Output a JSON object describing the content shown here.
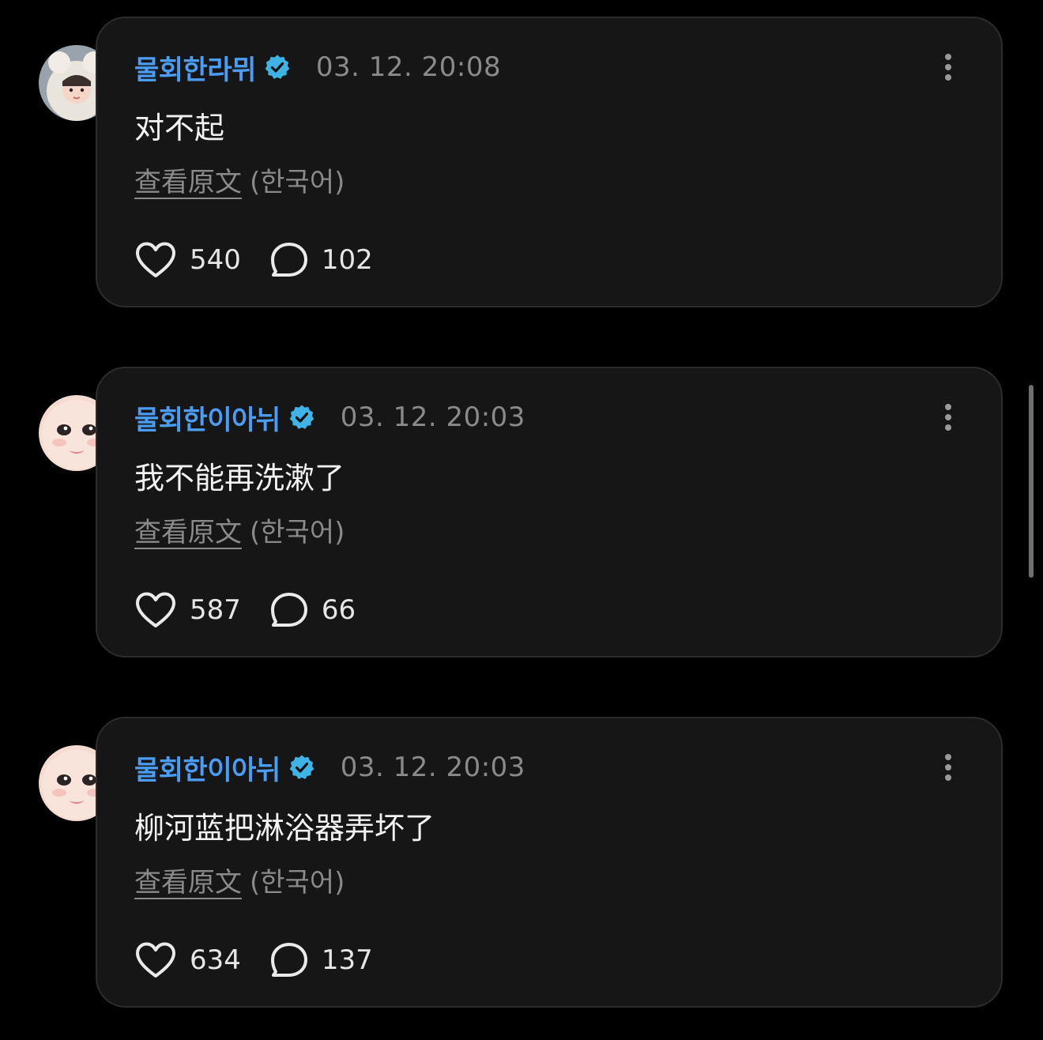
{
  "posts": [
    {
      "avatar_icon": "user-avatar-1",
      "username": "물회한라뮈",
      "timestamp": "03. 12. 20:08",
      "content": "对不起",
      "translate_label": "查看原文",
      "language": "(한국어)",
      "likes": "540",
      "comments": "102"
    },
    {
      "avatar_icon": "user-avatar-2",
      "username": "물회한이아뉘",
      "timestamp": "03. 12. 20:03",
      "content": "我不能再洗漱了",
      "translate_label": "查看原文",
      "language": "(한국어)",
      "likes": "587",
      "comments": "66"
    },
    {
      "avatar_icon": "user-avatar-2",
      "username": "물회한이아뉘",
      "timestamp": "03. 12. 20:03",
      "content": "柳河蓝把淋浴器弄坏了",
      "translate_label": "查看原文",
      "language": "(한국어)",
      "likes": "634",
      "comments": "137"
    }
  ],
  "colors": {
    "background": "#000000",
    "card": "#161616",
    "username": "#4a9df2",
    "verified_badge": "#3fb3e6",
    "muted_text": "#8a8a8a",
    "body_text": "#f2f2f2"
  },
  "icons": {
    "verified": "verified-badge-icon",
    "more": "more-vertical-icon",
    "like": "heart-icon",
    "comment": "comment-bubble-icon"
  }
}
